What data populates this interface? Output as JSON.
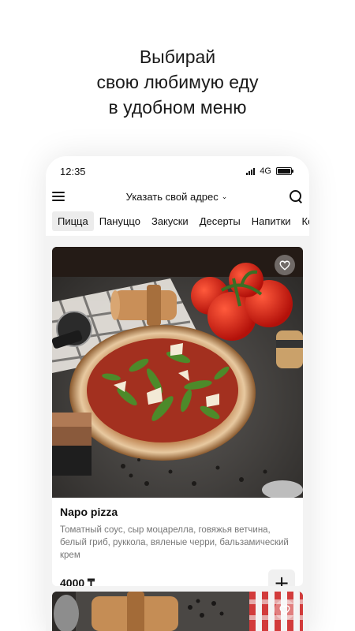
{
  "headline": {
    "line1": "Выбирай",
    "line2": "свою любимую еду",
    "line3": "в удобном меню"
  },
  "status_bar": {
    "time": "12:35",
    "network": "4G",
    "icons": [
      "signal-icon",
      "battery-icon"
    ]
  },
  "header": {
    "menu_icon": "hamburger-menu-icon",
    "address_label": "Указать свой адрес",
    "address_chevron": "⌄",
    "search_icon": "search-icon"
  },
  "tabs": [
    "Пицца",
    "Пануццо",
    "Закуски",
    "Десерты",
    "Напитки",
    "Ко"
  ],
  "active_tab": "Пицца",
  "products": [
    {
      "title": "Napo pizza",
      "description": "Томатный соус, сыр моцарелла, говяжья ветчина, белый гриб, руккола, вяленые черри, бальзамический крем",
      "price": "4000 ₸",
      "add_symbol": "+",
      "favorite_icon": "heart-outline-icon"
    }
  ],
  "colors": {
    "background": "#ffffff",
    "phone_bg": "#f3f3f3",
    "tab_active_bg": "#ececec",
    "description_text": "#777777"
  }
}
